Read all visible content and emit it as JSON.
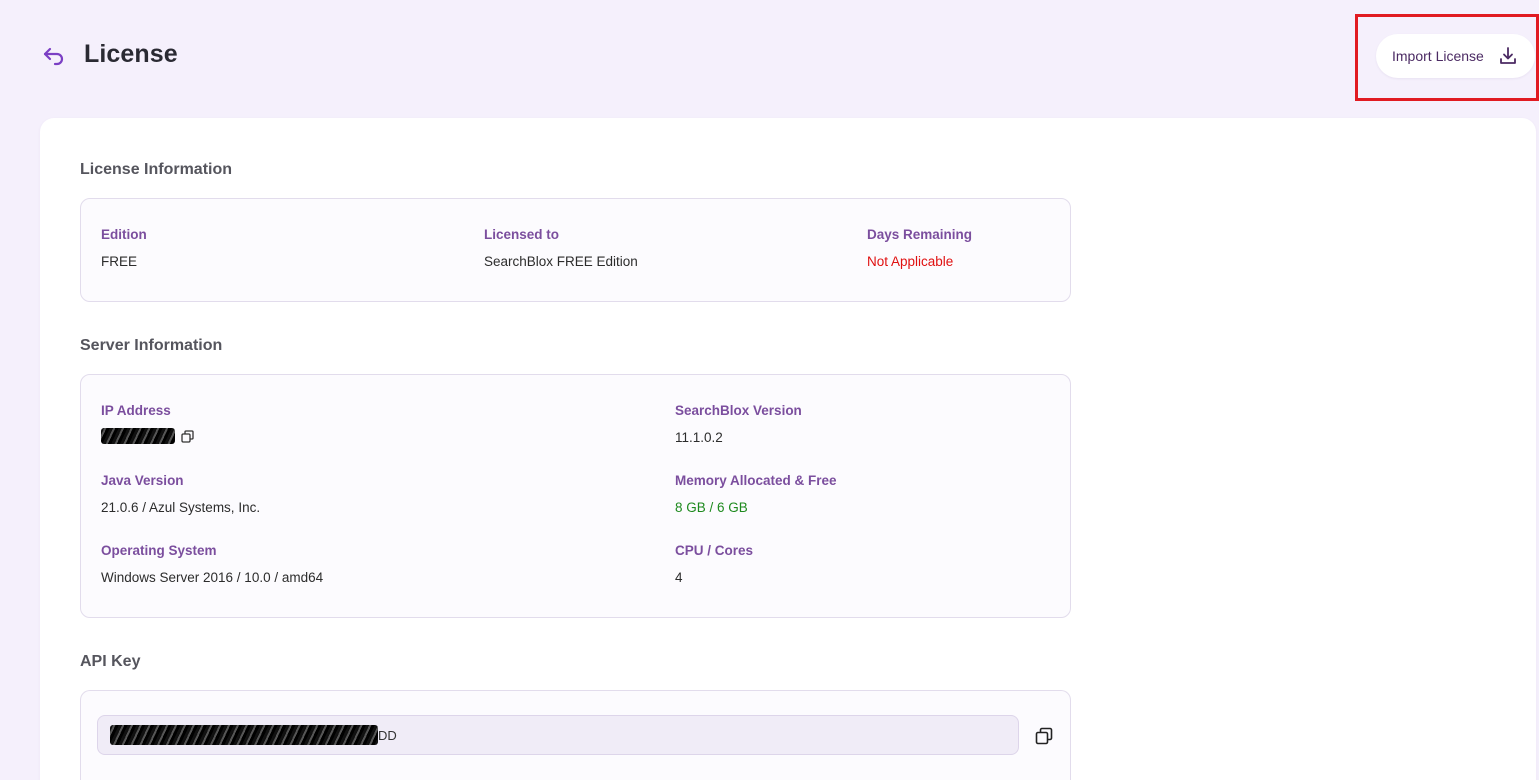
{
  "header": {
    "title": "License",
    "import_label": "Import License"
  },
  "license": {
    "section_title": "License Information",
    "edition_label": "Edition",
    "edition_value": "FREE",
    "licensed_to_label": "Licensed to",
    "licensed_to_value": "SearchBlox FREE Edition",
    "days_label": "Days Remaining",
    "days_value": "Not Applicable"
  },
  "server": {
    "section_title": "Server Information",
    "ip_label": "IP Address",
    "version_label": "SearchBlox Version",
    "version_value": "11.1.0.2",
    "java_label": "Java Version",
    "java_value": "21.0.6 / Azul Systems, Inc.",
    "memory_label": "Memory Allocated & Free",
    "memory_value": "8 GB / 6 GB",
    "os_label": "Operating System",
    "os_value": "Windows Server 2016 / 10.0 / amd64",
    "cpu_label": "CPU / Cores",
    "cpu_value": "4"
  },
  "api": {
    "section_title": "API Key",
    "key_suffix": "DD"
  },
  "icons": {
    "back": "back-arrow-icon",
    "import": "download-icon",
    "copy": "copy-icon"
  },
  "colors": {
    "accent": "#7b4e9e",
    "highlight": "#e11b22",
    "warning": "#e01010",
    "ok": "#1e8a1e",
    "background": "#f5f0fc"
  }
}
